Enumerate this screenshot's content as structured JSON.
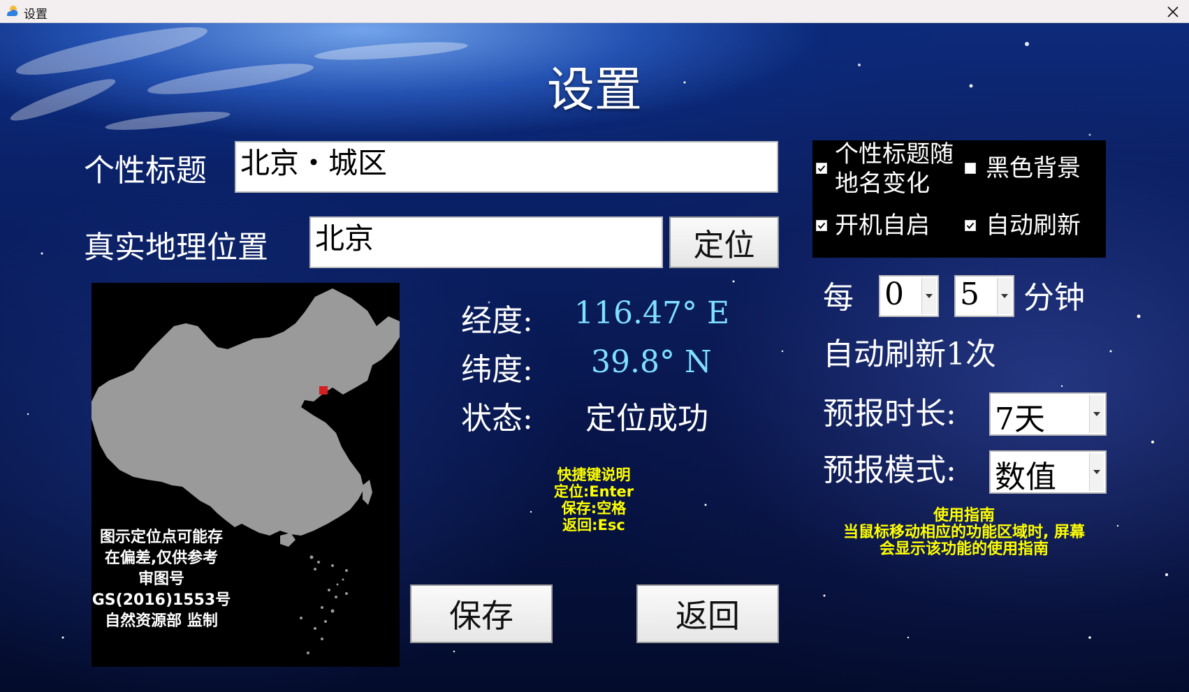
{
  "window": {
    "title": "设置"
  },
  "page_title": "设置",
  "form": {
    "custom_title_label": "个性标题",
    "custom_title_value": "北京・城区",
    "real_location_label": "真实地理位置",
    "real_location_value": "北京",
    "locate_button": "定位"
  },
  "map": {
    "note_lines": [
      "图示定位点可能存",
      "在偏差,仅供参考",
      "审图号",
      "GS(2016)1553号",
      "自然资源部 监制"
    ],
    "marker_color": "#d42020",
    "land_color": "#9a9a9a"
  },
  "location_info": {
    "longitude_label": "经度:",
    "longitude_value": "116.47° E",
    "latitude_label": "纬度:",
    "latitude_value": "39.8° N",
    "status_label": "状态:",
    "status_value": "定位成功",
    "value_color": "#7fe0ff"
  },
  "shortcuts": {
    "title": "快捷键说明",
    "lines": [
      "定位:Enter",
      "保存:空格",
      "返回:Esc"
    ]
  },
  "options": {
    "title_follow_label_line1": "个性标题随",
    "title_follow_label_line2": "地名变化",
    "title_follow_checked": true,
    "black_bg_label": "黑色背景",
    "black_bg_checked": false,
    "autostart_label": "开机自启",
    "autostart_checked": true,
    "autorefresh_label": "自动刷新",
    "autorefresh_checked": true
  },
  "refresh": {
    "every_label": "每",
    "hours_value": "0",
    "minutes_value": "5",
    "minutes_unit": "分钟",
    "suffix": "自动刷新1次"
  },
  "forecast": {
    "duration_label": "预报时长:",
    "duration_value": "7天",
    "mode_label": "预报模式:",
    "mode_value": "数值"
  },
  "guide": {
    "title": "使用指南",
    "line1": "当鼠标移动相应的功能区域时, 屏幕",
    "line2": "会显示该功能的使用指南"
  },
  "buttons": {
    "save": "保存",
    "back": "返回"
  },
  "icons": {
    "app": "weather-app-icon",
    "close": "close-icon",
    "checkbox": "check-icon",
    "dropdown": "dropdown-arrow-icon"
  }
}
